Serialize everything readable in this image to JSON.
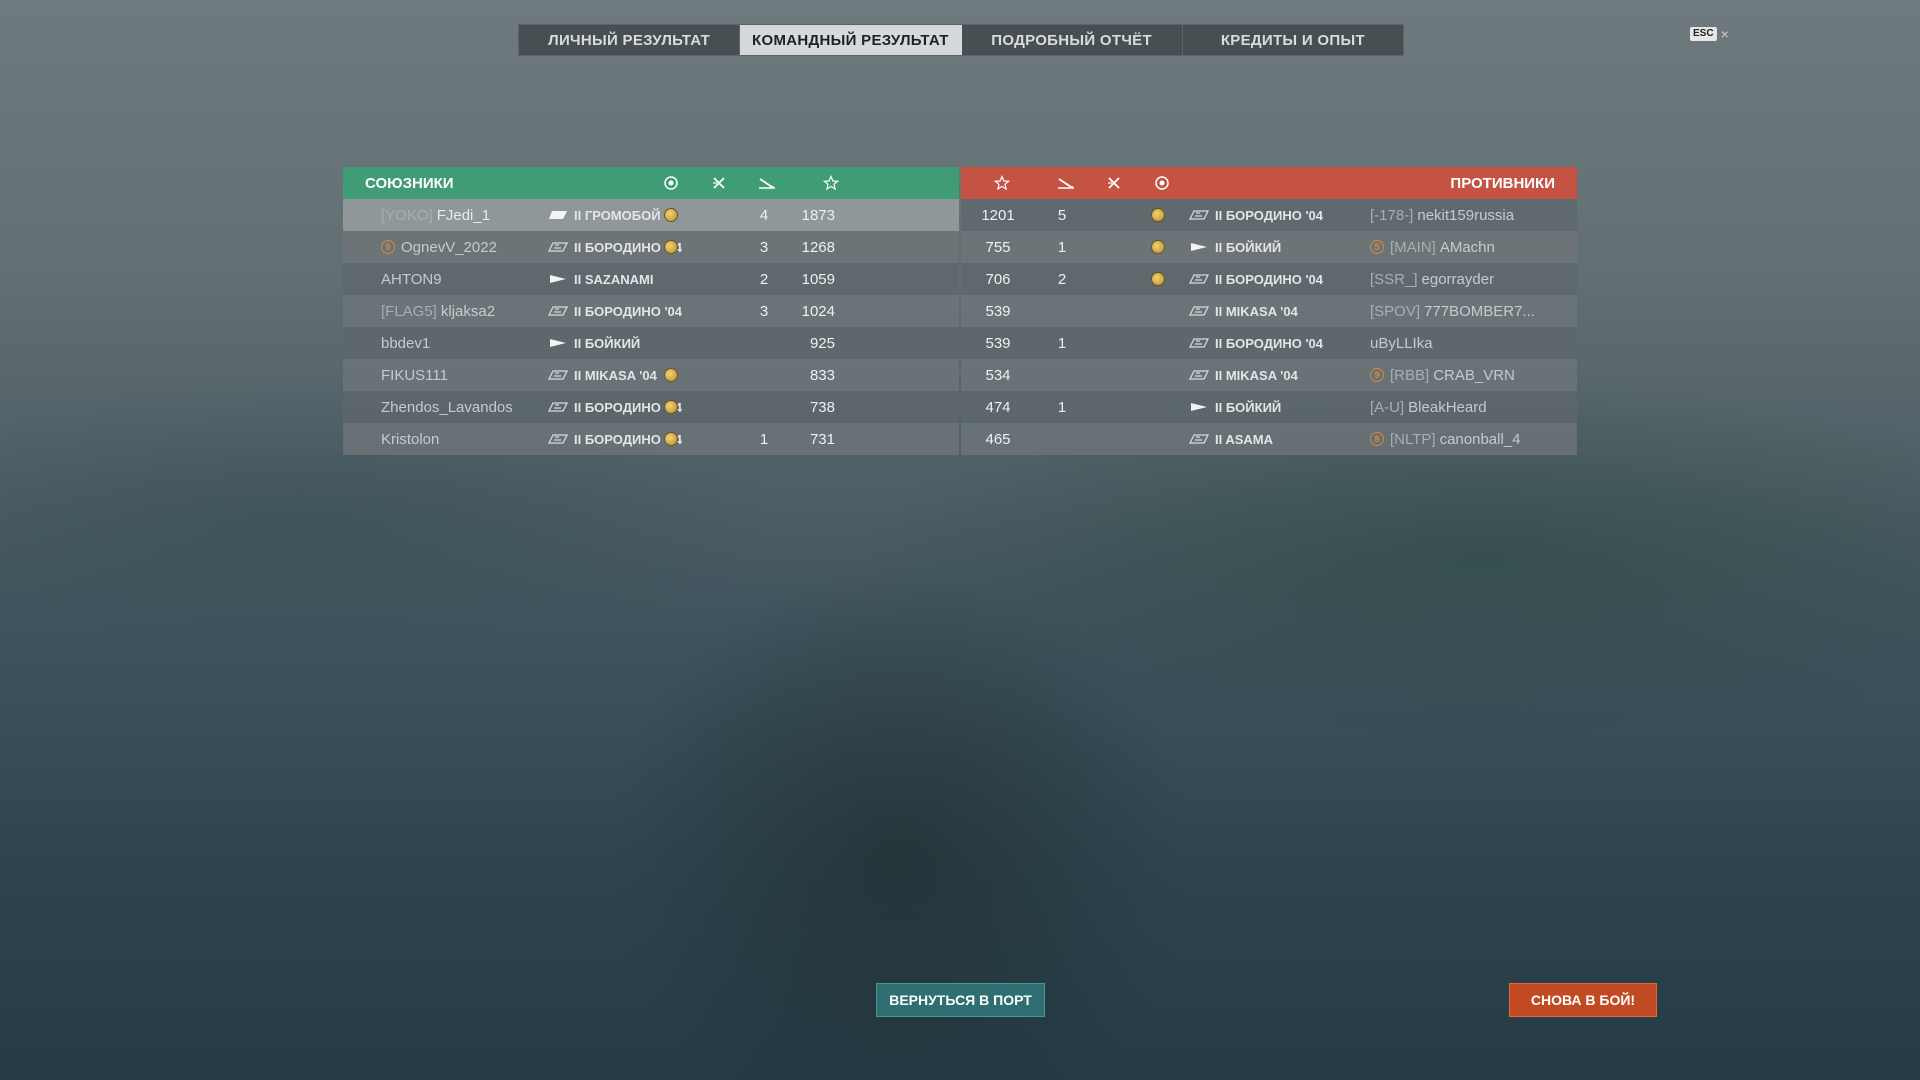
{
  "tabs": [
    {
      "label": "ЛИЧНЫЙ РЕЗУЛЬТАТ",
      "active": false
    },
    {
      "label": "КОМАНДНЫЙ РЕЗУЛЬТАТ",
      "active": true
    },
    {
      "label": "ПОДРОБНЫЙ ОТЧЁТ",
      "active": false
    },
    {
      "label": "КРЕДИТЫ И ОПЫТ",
      "active": false
    }
  ],
  "esc": {
    "key": "ESC",
    "close": "×"
  },
  "allies": {
    "title": "СОЮЗНИКИ",
    "columns": [
      "medal-icon",
      "destroyed-icon",
      "kills-icon",
      "star-icon"
    ],
    "rows": [
      {
        "clan": "[YOKO]",
        "name": "FJedi_1",
        "ship": "II ГРОМОБОЙ",
        "ship_type": "cruiser",
        "medal": true,
        "kills": "4",
        "score": "1873",
        "me": true
      },
      {
        "badge": "9",
        "clan": "",
        "name": "OgnevV_2022",
        "ship": "II БОРОДИНО '04",
        "ship_type": "battleship",
        "medal": true,
        "kills": "3",
        "score": "1268"
      },
      {
        "clan": "",
        "name": "AHTON9",
        "ship": "II SAZANAMI",
        "ship_type": "destroyer",
        "medal": false,
        "kills": "2",
        "score": "1059"
      },
      {
        "clan": "[FLAG5]",
        "name": "kljaksa2",
        "ship": "II БОРОДИНО '04",
        "ship_type": "battleship",
        "medal": false,
        "kills": "3",
        "score": "1024"
      },
      {
        "clan": "",
        "name": "bbdev1",
        "ship": "II БОЙКИЙ",
        "ship_type": "destroyer",
        "medal": false,
        "kills": "",
        "score": "925"
      },
      {
        "clan": "",
        "name": "FIKUS111",
        "ship": "II MIKASA '04",
        "ship_type": "battleship",
        "medal": true,
        "kills": "",
        "score": "833"
      },
      {
        "clan": "",
        "name": "Zhendos_Lavandos",
        "ship": "II БОРОДИНО '04",
        "ship_type": "battleship",
        "medal": true,
        "kills": "",
        "score": "738"
      },
      {
        "clan": "",
        "name": "Kristolon",
        "ship": "II БОРОДИНО '04",
        "ship_type": "battleship",
        "medal": true,
        "kills": "1",
        "score": "731"
      }
    ]
  },
  "enemies": {
    "title": "ПРОТИВНИКИ",
    "columns": [
      "star-icon",
      "kills-icon",
      "destroyed-icon",
      "medal-icon"
    ],
    "rows": [
      {
        "score": "1201",
        "kills": "5",
        "medal": true,
        "ship": "II БОРОДИНО '04",
        "ship_type": "battleship",
        "clan": "[-178-]",
        "name": "nekit159russia"
      },
      {
        "score": "755",
        "kills": "1",
        "medal": true,
        "ship": "II БОЙКИЙ",
        "ship_type": "destroyer",
        "badge": "5",
        "clan": "[MAIN]",
        "name": "AMachn"
      },
      {
        "score": "706",
        "kills": "2",
        "medal": true,
        "ship": "II БОРОДИНО '04",
        "ship_type": "battleship",
        "clan": "[SSR_]",
        "name": "egorrayder"
      },
      {
        "score": "539",
        "kills": "",
        "medal": false,
        "ship": "II MIKASA '04",
        "ship_type": "battleship",
        "clan": "[SPOV]",
        "name": "777BOMBER7..."
      },
      {
        "score": "539",
        "kills": "1",
        "medal": false,
        "ship": "II БОРОДИНО '04",
        "ship_type": "battleship",
        "clan": "",
        "name": "uByLLIka"
      },
      {
        "score": "534",
        "kills": "",
        "medal": false,
        "ship": "II MIKASA '04",
        "ship_type": "battleship",
        "badge": "9",
        "clan": "[RBB]",
        "name": "CRAB_VRN"
      },
      {
        "score": "474",
        "kills": "1",
        "medal": false,
        "ship": "II БОЙКИЙ",
        "ship_type": "destroyer",
        "clan": "[A-U]",
        "name": "BleakHeard"
      },
      {
        "score": "465",
        "kills": "",
        "medal": false,
        "ship": "II ASAMA",
        "ship_type": "battleship",
        "badge": "8",
        "clan": "[NLTP]",
        "name": "canonball_4"
      }
    ]
  },
  "buttons": {
    "port": "ВЕРНУТЬСЯ В ПОРТ",
    "battle": "СНОВА В БОЙ!"
  }
}
